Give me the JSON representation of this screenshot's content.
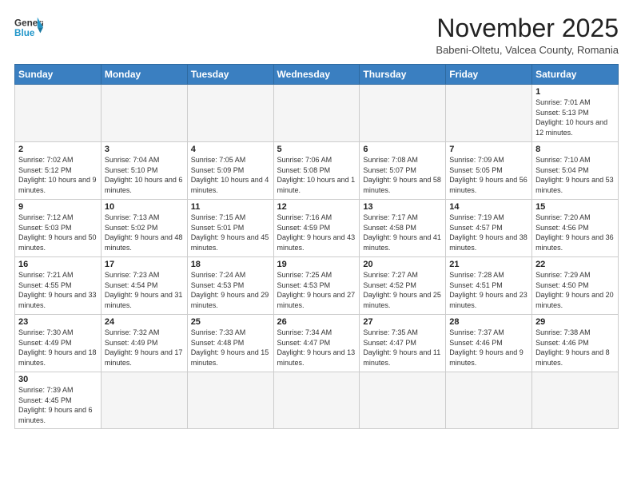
{
  "logo": {
    "line1": "General",
    "line2": "Blue"
  },
  "title": "November 2025",
  "subtitle": "Babeni-Oltetu, Valcea County, Romania",
  "headers": [
    "Sunday",
    "Monday",
    "Tuesday",
    "Wednesday",
    "Thursday",
    "Friday",
    "Saturday"
  ],
  "weeks": [
    [
      {
        "day": "",
        "info": ""
      },
      {
        "day": "",
        "info": ""
      },
      {
        "day": "",
        "info": ""
      },
      {
        "day": "",
        "info": ""
      },
      {
        "day": "",
        "info": ""
      },
      {
        "day": "",
        "info": ""
      },
      {
        "day": "1",
        "info": "Sunrise: 7:01 AM\nSunset: 5:13 PM\nDaylight: 10 hours\nand 12 minutes."
      }
    ],
    [
      {
        "day": "2",
        "info": "Sunrise: 7:02 AM\nSunset: 5:12 PM\nDaylight: 10 hours\nand 9 minutes."
      },
      {
        "day": "3",
        "info": "Sunrise: 7:04 AM\nSunset: 5:10 PM\nDaylight: 10 hours\nand 6 minutes."
      },
      {
        "day": "4",
        "info": "Sunrise: 7:05 AM\nSunset: 5:09 PM\nDaylight: 10 hours\nand 4 minutes."
      },
      {
        "day": "5",
        "info": "Sunrise: 7:06 AM\nSunset: 5:08 PM\nDaylight: 10 hours\nand 1 minute."
      },
      {
        "day": "6",
        "info": "Sunrise: 7:08 AM\nSunset: 5:07 PM\nDaylight: 9 hours\nand 58 minutes."
      },
      {
        "day": "7",
        "info": "Sunrise: 7:09 AM\nSunset: 5:05 PM\nDaylight: 9 hours\nand 56 minutes."
      },
      {
        "day": "8",
        "info": "Sunrise: 7:10 AM\nSunset: 5:04 PM\nDaylight: 9 hours\nand 53 minutes."
      }
    ],
    [
      {
        "day": "9",
        "info": "Sunrise: 7:12 AM\nSunset: 5:03 PM\nDaylight: 9 hours\nand 50 minutes."
      },
      {
        "day": "10",
        "info": "Sunrise: 7:13 AM\nSunset: 5:02 PM\nDaylight: 9 hours\nand 48 minutes."
      },
      {
        "day": "11",
        "info": "Sunrise: 7:15 AM\nSunset: 5:01 PM\nDaylight: 9 hours\nand 45 minutes."
      },
      {
        "day": "12",
        "info": "Sunrise: 7:16 AM\nSunset: 4:59 PM\nDaylight: 9 hours\nand 43 minutes."
      },
      {
        "day": "13",
        "info": "Sunrise: 7:17 AM\nSunset: 4:58 PM\nDaylight: 9 hours\nand 41 minutes."
      },
      {
        "day": "14",
        "info": "Sunrise: 7:19 AM\nSunset: 4:57 PM\nDaylight: 9 hours\nand 38 minutes."
      },
      {
        "day": "15",
        "info": "Sunrise: 7:20 AM\nSunset: 4:56 PM\nDaylight: 9 hours\nand 36 minutes."
      }
    ],
    [
      {
        "day": "16",
        "info": "Sunrise: 7:21 AM\nSunset: 4:55 PM\nDaylight: 9 hours\nand 33 minutes."
      },
      {
        "day": "17",
        "info": "Sunrise: 7:23 AM\nSunset: 4:54 PM\nDaylight: 9 hours\nand 31 minutes."
      },
      {
        "day": "18",
        "info": "Sunrise: 7:24 AM\nSunset: 4:53 PM\nDaylight: 9 hours\nand 29 minutes."
      },
      {
        "day": "19",
        "info": "Sunrise: 7:25 AM\nSunset: 4:53 PM\nDaylight: 9 hours\nand 27 minutes."
      },
      {
        "day": "20",
        "info": "Sunrise: 7:27 AM\nSunset: 4:52 PM\nDaylight: 9 hours\nand 25 minutes."
      },
      {
        "day": "21",
        "info": "Sunrise: 7:28 AM\nSunset: 4:51 PM\nDaylight: 9 hours\nand 23 minutes."
      },
      {
        "day": "22",
        "info": "Sunrise: 7:29 AM\nSunset: 4:50 PM\nDaylight: 9 hours\nand 20 minutes."
      }
    ],
    [
      {
        "day": "23",
        "info": "Sunrise: 7:30 AM\nSunset: 4:49 PM\nDaylight: 9 hours\nand 18 minutes."
      },
      {
        "day": "24",
        "info": "Sunrise: 7:32 AM\nSunset: 4:49 PM\nDaylight: 9 hours\nand 17 minutes."
      },
      {
        "day": "25",
        "info": "Sunrise: 7:33 AM\nSunset: 4:48 PM\nDaylight: 9 hours\nand 15 minutes."
      },
      {
        "day": "26",
        "info": "Sunrise: 7:34 AM\nSunset: 4:47 PM\nDaylight: 9 hours\nand 13 minutes."
      },
      {
        "day": "27",
        "info": "Sunrise: 7:35 AM\nSunset: 4:47 PM\nDaylight: 9 hours\nand 11 minutes."
      },
      {
        "day": "28",
        "info": "Sunrise: 7:37 AM\nSunset: 4:46 PM\nDaylight: 9 hours\nand 9 minutes."
      },
      {
        "day": "29",
        "info": "Sunrise: 7:38 AM\nSunset: 4:46 PM\nDaylight: 9 hours\nand 8 minutes."
      }
    ],
    [
      {
        "day": "30",
        "info": "Sunrise: 7:39 AM\nSunset: 4:45 PM\nDaylight: 9 hours\nand 6 minutes."
      },
      {
        "day": "",
        "info": ""
      },
      {
        "day": "",
        "info": ""
      },
      {
        "day": "",
        "info": ""
      },
      {
        "day": "",
        "info": ""
      },
      {
        "day": "",
        "info": ""
      },
      {
        "day": "",
        "info": ""
      }
    ]
  ]
}
